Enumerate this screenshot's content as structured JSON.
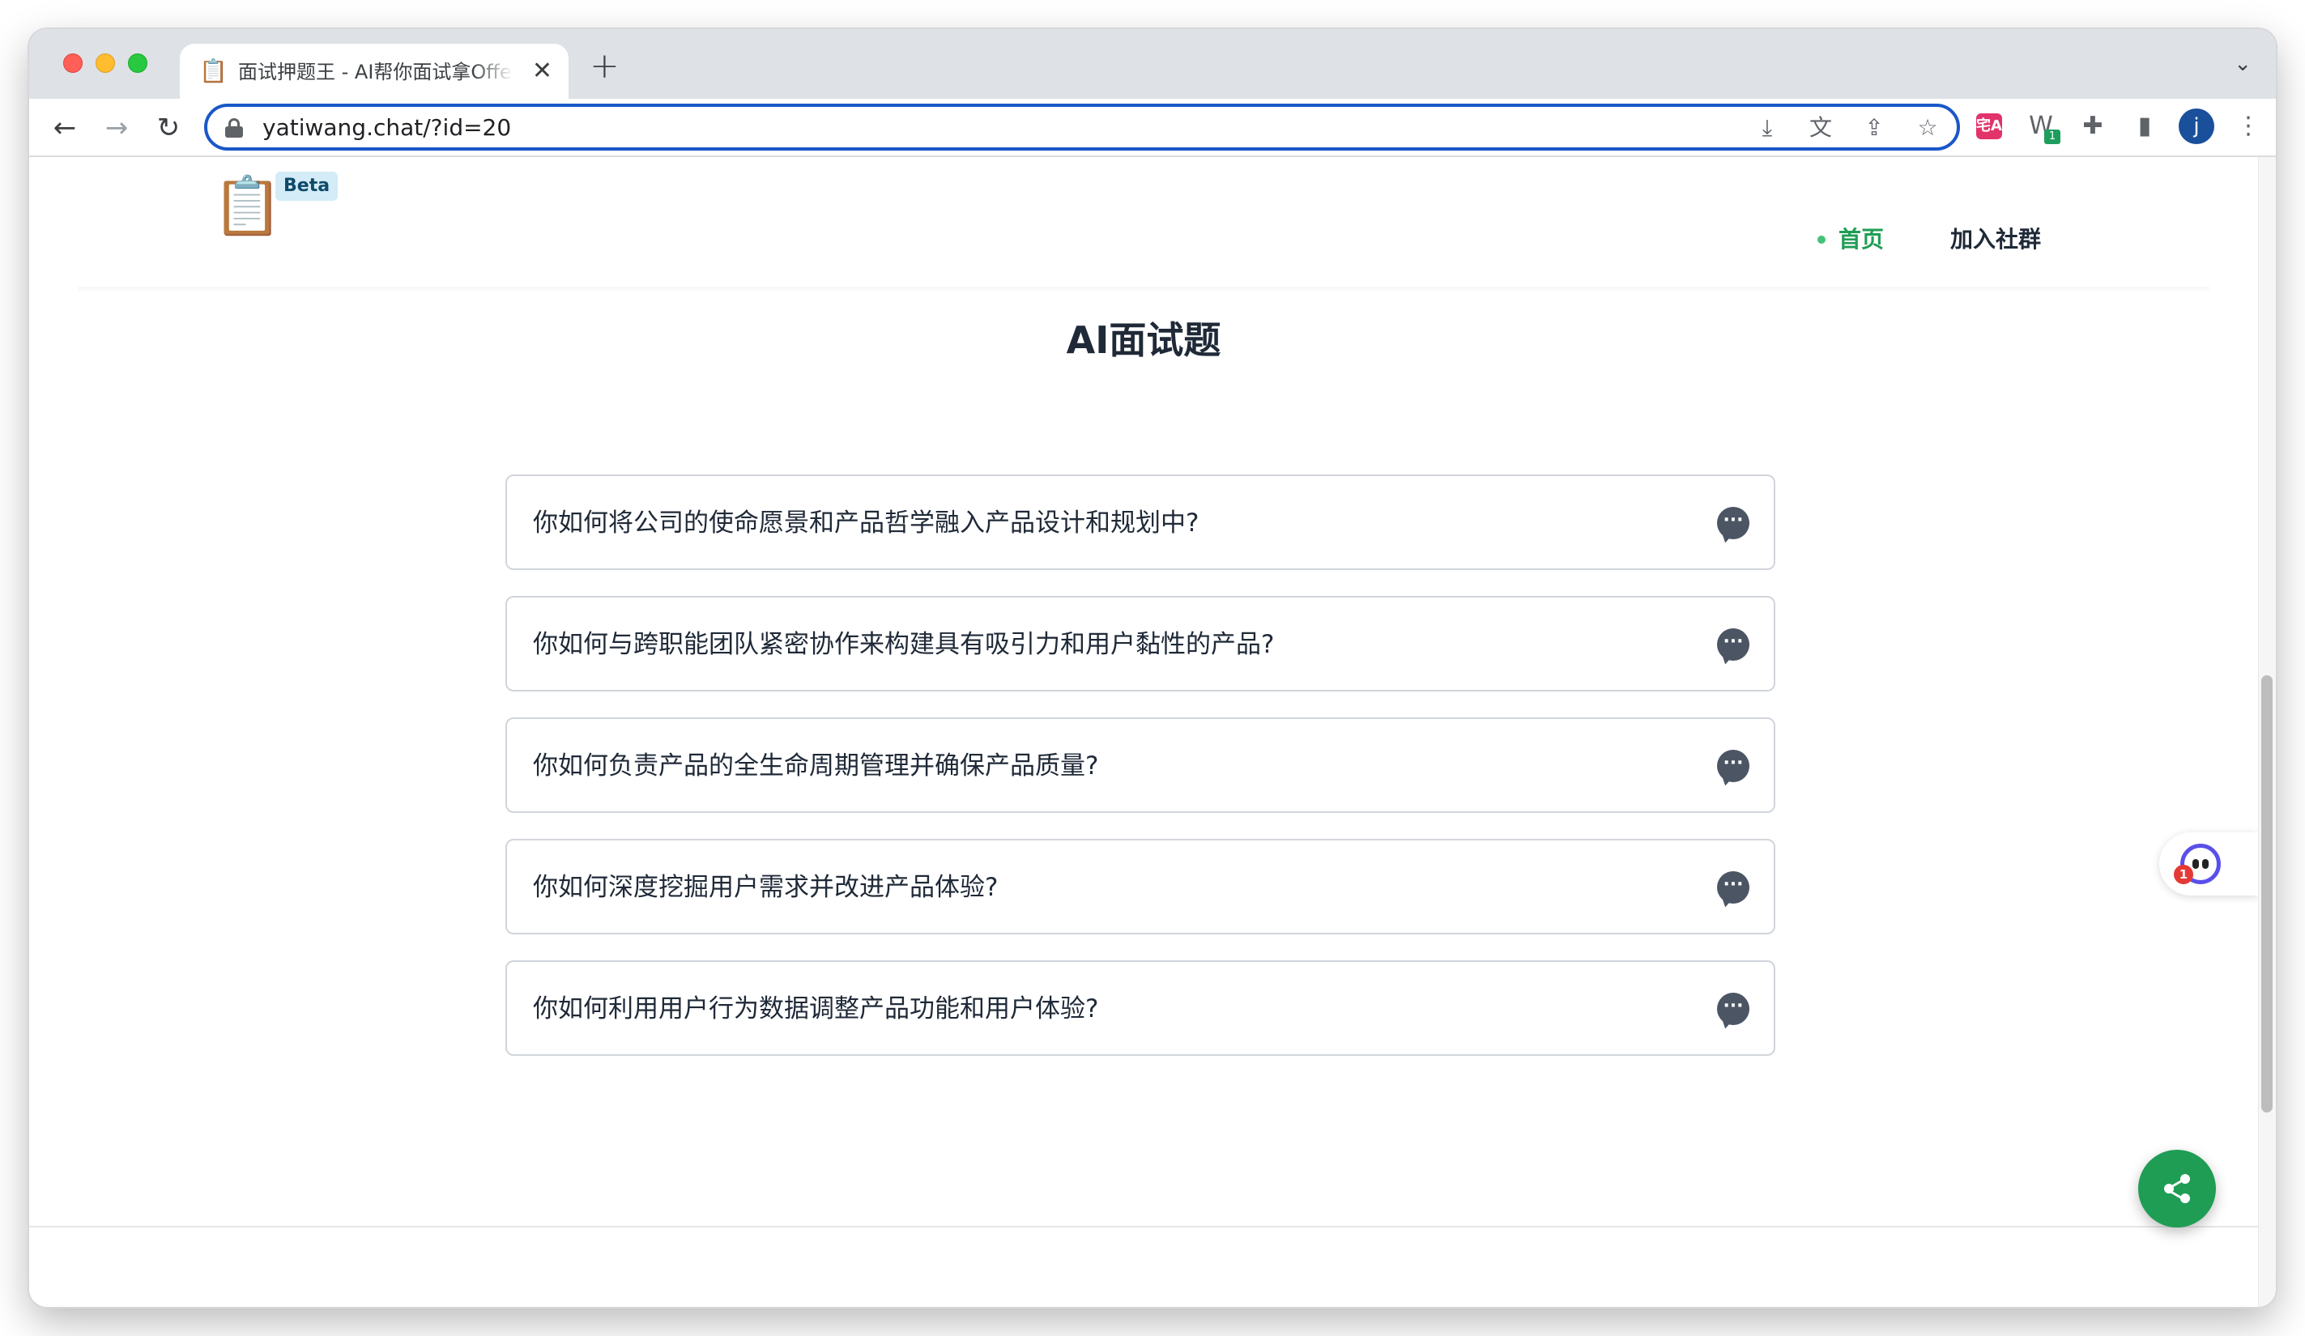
{
  "browser": {
    "tab": {
      "favicon": "📋",
      "title": "面试押题王 - AI帮你面试拿Offer",
      "close": "✕"
    },
    "new_tab": "+",
    "tab_dropdown": "⌄",
    "nav": {
      "back": "←",
      "forward": "→",
      "reload": "↻"
    },
    "url": "yatiwang.chat/?id=20",
    "omnibox_icons": [
      "download-icon",
      "translate-icon",
      "share-icon",
      "bookmark-star-icon"
    ],
    "omnibox_glyphs": [
      "⤓",
      "文",
      "⇪",
      "☆"
    ],
    "extensions": {
      "pink_label": "宅A",
      "w_label": "W",
      "w_badge": "1",
      "puzzle": "✚",
      "sidepanel": "▮",
      "avatar_letter": "j",
      "menu": "⋮"
    }
  },
  "site": {
    "logo": "📋",
    "beta": "Beta",
    "nav": {
      "home": "首页",
      "join": "加入社群"
    },
    "accent": "#1f9d55"
  },
  "page": {
    "title": "AI面试题",
    "questions": [
      "你如何将公司的使命愿景和产品哲学融入产品设计和规划中?",
      "你如何与跨职能团队紧密协作来构建具有吸引力和用户黏性的产品?",
      "你如何负责产品的全生命周期管理并确保产品质量?",
      "你如何深度挖掘用户需求并改进产品体验?",
      "你如何利用用户行为数据调整产品功能和用户体验?"
    ],
    "chat_icon_glyph": "···"
  },
  "widget": {
    "badge": "1"
  }
}
